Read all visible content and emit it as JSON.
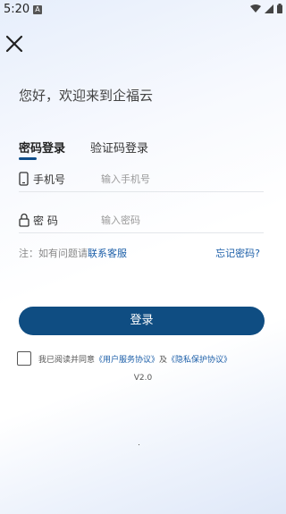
{
  "status_bar": {
    "time": "5:20",
    "notification_badge": "A",
    "icons": [
      "wifi-icon",
      "signal-icon",
      "battery-icon"
    ]
  },
  "header": {
    "close_icon": "close-icon"
  },
  "welcome": "您好，欢迎来到企福云",
  "tabs": [
    {
      "label": "密码登录",
      "active": true
    },
    {
      "label": "验证码登录",
      "active": false
    }
  ],
  "fields": {
    "phone": {
      "icon": "phone-icon",
      "label": "手机号",
      "placeholder": "输入手机号",
      "value": ""
    },
    "password": {
      "icon": "lock-icon",
      "label": "密  码",
      "placeholder": "输入密码",
      "value": ""
    }
  },
  "note": {
    "prefix": "注：如有问题请",
    "link": "联系客服"
  },
  "forgot_password": "忘记密码?",
  "login_button": "登录",
  "agreement": {
    "checked": false,
    "prefix": "我已阅读并同意",
    "user_agreement": "《用户服务协议》",
    "and": "及",
    "privacy_policy": "《隐私保护协议》"
  },
  "version": "V2.0",
  "colors": {
    "primary": "#0f4d82",
    "link": "#1b5ea8",
    "background_tint": "#e6eefb"
  }
}
